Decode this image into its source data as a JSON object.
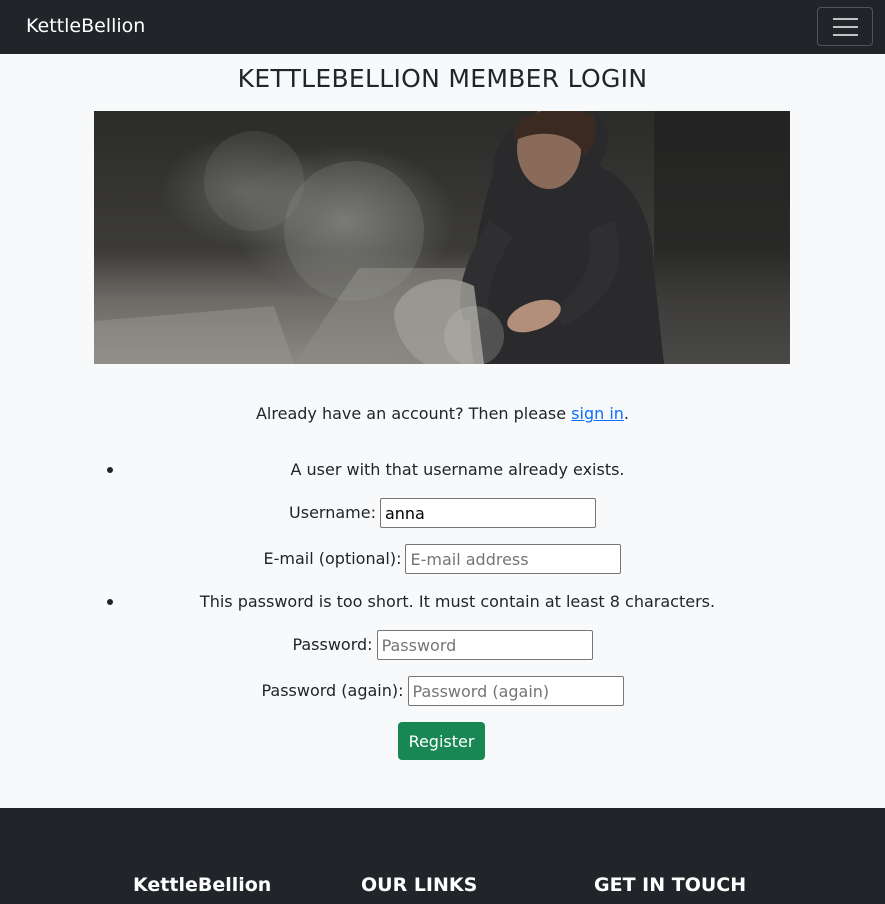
{
  "navbar": {
    "brand": "KettleBellion",
    "menu_icon": "hamburger-menu-icon"
  },
  "page": {
    "title": "KETTLEBELLION MEMBER LOGIN",
    "hero_image": "woman-chalking-hands-photo"
  },
  "signin": {
    "prefix": "Already have an account? Then please ",
    "link_text": "sign in",
    "suffix": "."
  },
  "form": {
    "username_error": "A user with that username already exists.",
    "username_label": "Username:",
    "username_value": "anna",
    "email_label": "E-mail (optional):",
    "email_placeholder": "E-mail address",
    "password_error": "This password is too short. It must contain at least 8 characters.",
    "password_label": "Password:",
    "password_placeholder": "Password",
    "password2_label": "Password (again):",
    "password2_placeholder": "Password (again)",
    "submit_label": "Register",
    "submit_color": "#198754"
  },
  "footer": {
    "brand": "KettleBellion",
    "links_heading": "OUR LINKS",
    "contact_heading": "GET IN TOUCH"
  },
  "colors": {
    "navbar_bg": "#212529",
    "link": "#0d6efd",
    "page_bg": "#f8f9fa"
  }
}
